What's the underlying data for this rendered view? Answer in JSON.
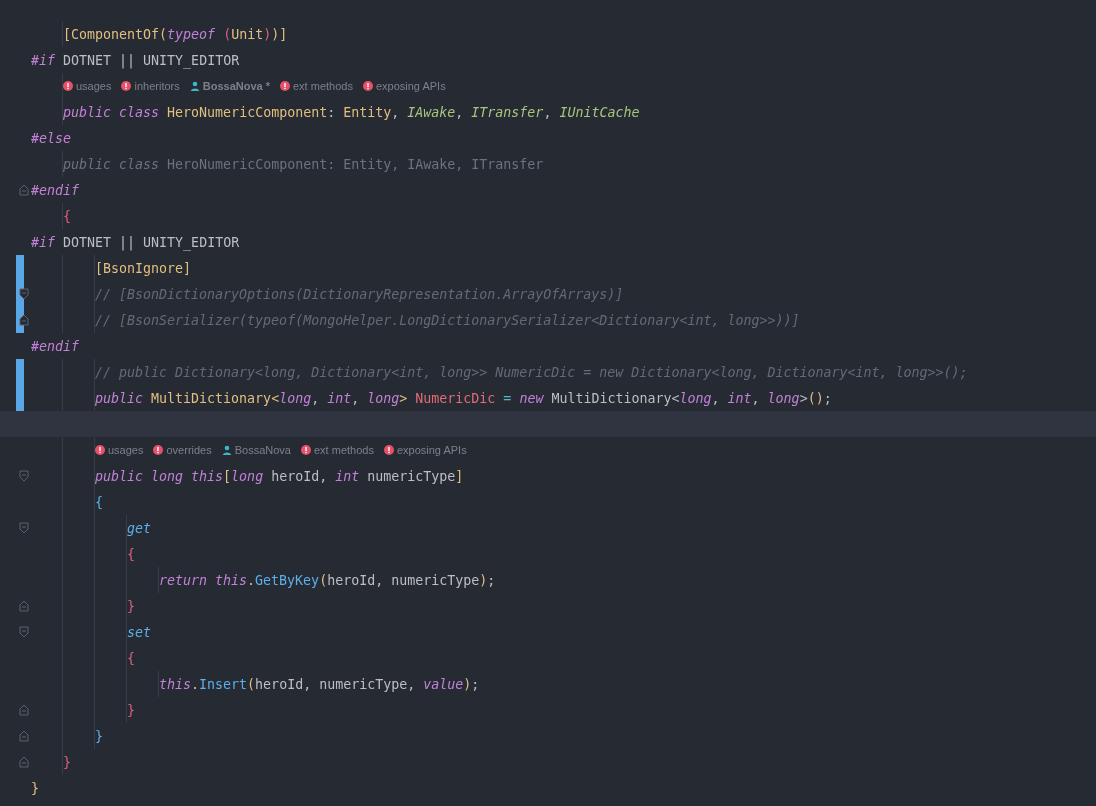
{
  "editor": {
    "lines": [
      {
        "kind": "block",
        "children": [
          {
            "kind": "code",
            "changed": false,
            "current": false,
            "tokens": [
              {
                "text": "[ComponentOf(",
                "kind": "type"
              },
              {
                "text": "typeof",
                "kind": "keyword"
              },
              {
                "text": " (",
                "kind": "brace_pink"
              },
              {
                "text": "Unit",
                "kind": "type"
              },
              {
                "text": ")",
                "kind": "brace_pink"
              },
              {
                "text": ")]",
                "kind": "type"
              }
            ]
          }
        ]
      },
      {
        "kind": "code",
        "changed": false,
        "current": false,
        "tokens": [
          {
            "text": "#if",
            "kind": "keyword"
          },
          {
            "text": " DOTNET || UNITY_EDITOR",
            "kind": "plain"
          }
        ]
      },
      {
        "kind": "block",
        "children": [
          {
            "kind": "hints",
            "changed": false,
            "current": false,
            "items": [
              {
                "kind": "error",
                "text": "usages",
                "bold": false
              },
              {
                "kind": "error",
                "text": "inheritors",
                "bold": false
              },
              {
                "kind": "user",
                "text": "BossaNova *",
                "bold": true
              },
              {
                "kind": "error",
                "text": "ext methods",
                "bold": false
              },
              {
                "kind": "error",
                "text": "exposing APIs",
                "bold": false
              }
            ]
          },
          {
            "kind": "code",
            "changed": false,
            "current": false,
            "tokens": [
              {
                "text": "public class ",
                "kind": "keyword"
              },
              {
                "text": "HeroNumericComponent",
                "kind": "type"
              },
              {
                "text": ": ",
                "kind": "plain"
              },
              {
                "text": "Entity",
                "kind": "type"
              },
              {
                "text": ", ",
                "kind": "plain"
              },
              {
                "text": "IAwake",
                "kind": "interface"
              },
              {
                "text": ", ",
                "kind": "plain"
              },
              {
                "text": "ITransfer",
                "kind": "interface"
              },
              {
                "text": ", ",
                "kind": "plain"
              },
              {
                "text": "IUnitCache",
                "kind": "interface"
              }
            ]
          }
        ]
      },
      {
        "kind": "code",
        "changed": false,
        "current": false,
        "tokens": [
          {
            "text": "#else",
            "kind": "keyword"
          }
        ]
      },
      {
        "kind": "block",
        "children": [
          {
            "kind": "code",
            "changed": false,
            "current": false,
            "tokens": [
              {
                "text": "public class",
                "kind": "inactive_keyword"
              },
              {
                "text": " HeroNumericComponent: Entity, IAwake, ITransfer",
                "kind": "inactive"
              }
            ]
          }
        ]
      },
      {
        "kind": "code",
        "changed": false,
        "current": false,
        "fold_start": false,
        "fold_end": true,
        "tokens": [
          {
            "text": "#endif",
            "kind": "keyword"
          }
        ]
      },
      {
        "kind": "block",
        "children": [
          {
            "kind": "code",
            "changed": false,
            "current": false,
            "tokens": [
              {
                "text": "{",
                "kind": "brace_pink"
              }
            ]
          }
        ]
      },
      {
        "kind": "code",
        "changed": false,
        "current": false,
        "tokens": [
          {
            "text": "#if",
            "kind": "keyword"
          },
          {
            "text": " DOTNET || UNITY_EDITOR",
            "kind": "plain"
          }
        ]
      },
      {
        "kind": "block",
        "children": [
          {
            "kind": "block",
            "children": [
              {
                "kind": "code",
                "changed": true,
                "current": false,
                "tokens": [
                  {
                    "text": "[BsonIgnore]",
                    "kind": "type"
                  }
                ]
              },
              {
                "kind": "code",
                "changed": true,
                "current": false,
                "fold_start": true,
                "fold_end": false,
                "tokens": [
                  {
                    "text": "// [BsonDictionaryOptions(DictionaryRepresentation.ArrayOfArrays)]",
                    "kind": "comment"
                  }
                ]
              },
              {
                "kind": "code",
                "changed": true,
                "current": false,
                "fold_start": false,
                "fold_end": true,
                "tokens": [
                  {
                    "text": "// [BsonSerializer(typeof(MongoHelper.LongDictionarySerializer<Dictionary<int, long>>))]",
                    "kind": "comment"
                  }
                ]
              }
            ]
          }
        ]
      },
      {
        "kind": "code",
        "changed": false,
        "current": false,
        "tokens": [
          {
            "text": "#endif",
            "kind": "keyword"
          }
        ]
      },
      {
        "kind": "block",
        "children": [
          {
            "kind": "block",
            "children": [
              {
                "kind": "code",
                "changed": true,
                "current": false,
                "tokens": [
                  {
                    "text": "// public Dictionary<long, Dictionary<int, long>> NumericDic = new Dictionary<long, Dictionary<int, long>>();",
                    "kind": "comment"
                  }
                ]
              },
              {
                "kind": "code",
                "changed": true,
                "current": false,
                "tokens": [
                  {
                    "text": "public ",
                    "kind": "keyword"
                  },
                  {
                    "text": "MultiDictionary<",
                    "kind": "type"
                  },
                  {
                    "text": "long",
                    "kind": "keyword"
                  },
                  {
                    "text": ", ",
                    "kind": "plain"
                  },
                  {
                    "text": "int",
                    "kind": "keyword"
                  },
                  {
                    "text": ", ",
                    "kind": "plain"
                  },
                  {
                    "text": "long",
                    "kind": "keyword"
                  },
                  {
                    "text": "> ",
                    "kind": "type"
                  },
                  {
                    "text": "NumericDic",
                    "kind": "field"
                  },
                  {
                    "text": " = ",
                    "kind": "operator"
                  },
                  {
                    "text": "new",
                    "kind": "keyword"
                  },
                  {
                    "text": " MultiDictionary<",
                    "kind": "plain"
                  },
                  {
                    "text": "long",
                    "kind": "keyword"
                  },
                  {
                    "text": ", ",
                    "kind": "plain"
                  },
                  {
                    "text": "int",
                    "kind": "keyword"
                  },
                  {
                    "text": ", ",
                    "kind": "plain"
                  },
                  {
                    "text": "long",
                    "kind": "keyword"
                  },
                  {
                    "text": ">",
                    "kind": "plain"
                  },
                  {
                    "text": "()",
                    "kind": "type"
                  },
                  {
                    "text": ";",
                    "kind": "plain"
                  }
                ]
              }
            ]
          }
        ]
      },
      {
        "kind": "code",
        "changed": false,
        "current": true
      },
      {
        "kind": "block",
        "children": [
          {
            "kind": "block",
            "children": [
              {
                "kind": "hints",
                "changed": false,
                "current": false,
                "items": [
                  {
                    "kind": "error",
                    "text": "usages",
                    "bold": false
                  },
                  {
                    "kind": "error",
                    "text": "overrides",
                    "bold": false
                  },
                  {
                    "kind": "user",
                    "text": "BossaNova",
                    "bold": false
                  },
                  {
                    "kind": "error",
                    "text": "ext methods",
                    "bold": false
                  },
                  {
                    "kind": "error",
                    "text": "exposing APIs",
                    "bold": false
                  }
                ]
              },
              {
                "kind": "code",
                "changed": false,
                "current": false,
                "fold_start": true,
                "fold_end": false,
                "tokens": [
                  {
                    "text": "public long this",
                    "kind": "keyword"
                  },
                  {
                    "text": "[",
                    "kind": "type"
                  },
                  {
                    "text": "long",
                    "kind": "keyword"
                  },
                  {
                    "text": " heroId, ",
                    "kind": "plain"
                  },
                  {
                    "text": "int",
                    "kind": "keyword"
                  },
                  {
                    "text": " numericType",
                    "kind": "plain"
                  },
                  {
                    "text": "]",
                    "kind": "type"
                  }
                ]
              },
              {
                "kind": "code",
                "changed": false,
                "current": false,
                "tokens": [
                  {
                    "text": "{",
                    "kind": "brace_blue"
                  }
                ]
              },
              {
                "kind": "block",
                "children": [
                  {
                    "kind": "code",
                    "changed": false,
                    "current": false,
                    "fold_start": true,
                    "fold_end": false,
                    "tokens": [
                      {
                        "text": "get",
                        "kind": "accessor"
                      }
                    ]
                  },
                  {
                    "kind": "code",
                    "changed": false,
                    "current": false,
                    "tokens": [
                      {
                        "text": "{",
                        "kind": "brace_pink"
                      }
                    ]
                  },
                  {
                    "kind": "block",
                    "children": [
                      {
                        "kind": "code",
                        "changed": false,
                        "current": false,
                        "tokens": [
                          {
                            "text": "return this",
                            "kind": "keyword"
                          },
                          {
                            "text": ".",
                            "kind": "plain"
                          },
                          {
                            "text": "GetByKey",
                            "kind": "method"
                          },
                          {
                            "text": "(",
                            "kind": "type"
                          },
                          {
                            "text": "heroId, numericType",
                            "kind": "plain"
                          },
                          {
                            "text": ")",
                            "kind": "type"
                          },
                          {
                            "text": ";",
                            "kind": "plain"
                          }
                        ]
                      }
                    ]
                  },
                  {
                    "kind": "code",
                    "changed": false,
                    "current": false,
                    "fold_start": false,
                    "fold_end": true,
                    "tokens": [
                      {
                        "text": "}",
                        "kind": "brace_pink"
                      }
                    ]
                  },
                  {
                    "kind": "code",
                    "changed": false,
                    "current": false,
                    "fold_start": true,
                    "fold_end": false,
                    "tokens": [
                      {
                        "text": "set",
                        "kind": "accessor"
                      }
                    ]
                  },
                  {
                    "kind": "code",
                    "changed": false,
                    "current": false,
                    "tokens": [
                      {
                        "text": "{",
                        "kind": "brace_pink"
                      }
                    ]
                  },
                  {
                    "kind": "block",
                    "children": [
                      {
                        "kind": "code",
                        "changed": false,
                        "current": false,
                        "tokens": [
                          {
                            "text": "this",
                            "kind": "keyword"
                          },
                          {
                            "text": ".",
                            "kind": "plain"
                          },
                          {
                            "text": "Insert",
                            "kind": "method"
                          },
                          {
                            "text": "(",
                            "kind": "type"
                          },
                          {
                            "text": "heroId, numericType, ",
                            "kind": "plain"
                          },
                          {
                            "text": "value",
                            "kind": "keyword"
                          },
                          {
                            "text": ")",
                            "kind": "type"
                          },
                          {
                            "text": ";",
                            "kind": "plain"
                          }
                        ]
                      }
                    ]
                  },
                  {
                    "kind": "code",
                    "changed": false,
                    "current": false,
                    "fold_start": false,
                    "fold_end": true,
                    "tokens": [
                      {
                        "text": "}",
                        "kind": "brace_pink"
                      }
                    ]
                  }
                ]
              },
              {
                "kind": "code",
                "changed": false,
                "current": false,
                "fold_start": false,
                "fold_end": true,
                "tokens": [
                  {
                    "text": "}",
                    "kind": "brace_blue"
                  }
                ]
              }
            ]
          },
          {
            "kind": "code",
            "changed": false,
            "current": false,
            "fold_start": false,
            "fold_end": true,
            "tokens": [
              {
                "text": "}",
                "kind": "brace_pink"
              }
            ]
          }
        ]
      },
      {
        "kind": "code",
        "changed": false,
        "current": false,
        "tokens": [
          {
            "text": "}",
            "kind": "type"
          }
        ]
      }
    ]
  }
}
